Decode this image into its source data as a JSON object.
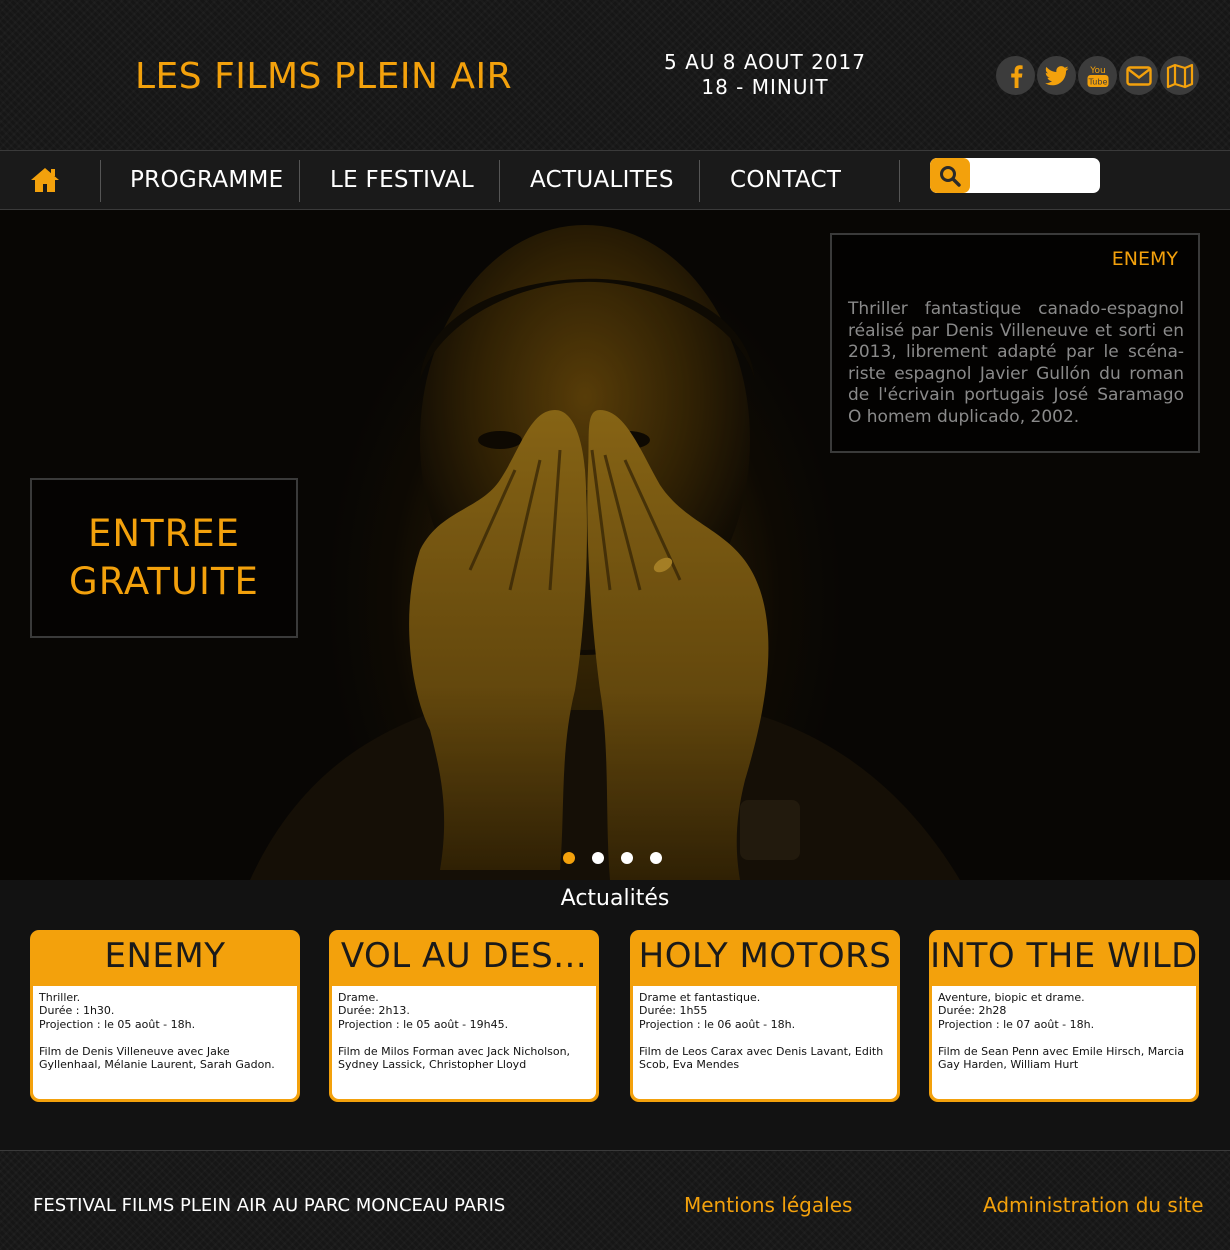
{
  "header": {
    "site_title": "LES FILMS PLEIN AIR",
    "dates_line1": "5 AU 8 AOUT 2017",
    "dates_line2": "18 - MINUIT",
    "social": [
      "facebook-icon",
      "twitter-icon",
      "youtube-icon",
      "envelope-icon",
      "map-icon"
    ],
    "youtube_text_top": "You",
    "youtube_text_bottom": "Tube"
  },
  "nav": {
    "home_icon": "home-icon",
    "items": [
      "PROGRAMME",
      "LE FESTIVAL",
      "ACTUALITES",
      "CONTACT"
    ],
    "search_placeholder": "",
    "search_icon": "search-icon"
  },
  "hero": {
    "entree_line1": "ENTREE",
    "entree_line2": "GRATUITE",
    "film_title": "ENEMY",
    "film_desc": "Thriller fantastique canado-espagnol réalisé par Denis Villeneuve et sorti en 2013, librement adapté par le scéna-riste espagnol Javier Gullón du roman de l'écrivain portugais José Saramago O homem duplicado, 2002.",
    "slides_total": 4,
    "active_slide": 1
  },
  "news": {
    "title": "Actualités",
    "cards": [
      {
        "title": "ENEMY",
        "genre": "Thriller.",
        "duration": "Durée : 1h30.",
        "projection": "Projection : le 05 août - 18h.",
        "credits": "Film de Denis Villeneuve avec Jake Gyllenhaal, Mélanie Laurent, Sarah Gadon."
      },
      {
        "title": "VOL AU DES...",
        "genre": "Drame.",
        "duration": "Durée: 2h13.",
        "projection": "Projection : le 05 août - 19h45.",
        "credits": "Film de Milos Forman avec Jack Nicholson, Sydney Lassick, Christopher Lloyd"
      },
      {
        "title": "HOLY MOTORS",
        "genre": "Drame et fantastique.",
        "duration": "Durée: 1h55",
        "projection": "Projection : le 06 août - 18h.",
        "credits": "Film de Leos Carax avec Denis Lavant, Edith Scob, Eva Mendes"
      },
      {
        "title": "INTO THE WILD",
        "genre": "Aventure, biopic et drame.",
        "duration": "Durée: 2h28",
        "projection": "Projection : le 07 août - 18h.",
        "credits": "Film de Sean Penn avec Emile Hirsch, Marcia Gay Harden, William Hurt"
      }
    ]
  },
  "footer": {
    "left_text": "FESTIVAL FILMS PLEIN AIR AU PARC MONCEAU PARIS",
    "mentions": "Mentions légales",
    "admin": "Administration du site"
  },
  "colors": {
    "accent": "#f3a10c",
    "background": "#121212",
    "header_bg": "#161616"
  }
}
